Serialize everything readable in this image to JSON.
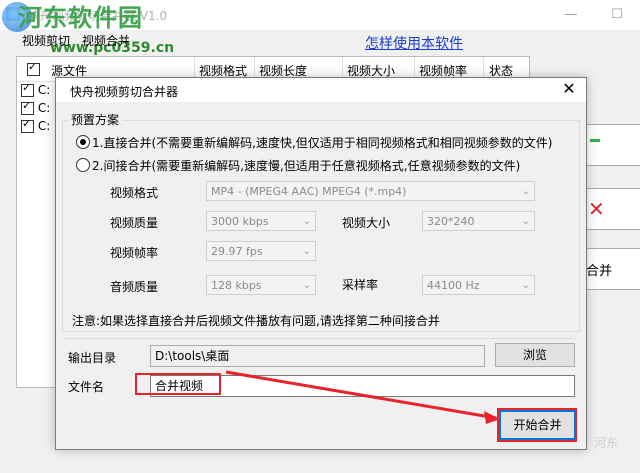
{
  "main_window": {
    "title": "快舟视频剪切合并器 V1.0",
    "menu": [
      "视频剪切",
      "视频合并"
    ],
    "help_link": "怎样使用本软件",
    "columns": [
      "源文件",
      "视频格式",
      "视频长度",
      "视频大小",
      "视频帧率",
      "状态"
    ],
    "row_prefix": [
      "C:",
      "C:",
      "C:"
    ],
    "side_button_label": "合并"
  },
  "watermark": {
    "site_name": "河东软件园",
    "url": "www.pc0359.cn",
    "corner_text": "河东"
  },
  "dialog": {
    "title": "快舟视频剪切合并器",
    "close_icon": "close-icon",
    "preset_label": "预置方案",
    "option1": "1.直接合并(不需要重新编解码,速度快,但仅适用于相同视频格式和相同视频参数的文件)",
    "option2": "2.间接合并(需要重新编解码,速度慢,但适用于任意视频格式,任意视频参数的文件)",
    "option1_selected": true,
    "fields": {
      "format_label": "视频格式",
      "format_value": "MP4 - (MPEG4 AAC) MPEG4 (*.mp4)",
      "quality_label": "视频质量",
      "quality_value": "3000 kbps",
      "size_label": "视频大小",
      "size_value": "320*240",
      "framerate_label": "视频帧率",
      "framerate_value": "29.97 fps",
      "audio_label": "音频质量",
      "audio_value": "128 kbps",
      "samplerate_label": "采样率",
      "samplerate_value": "44100 Hz"
    },
    "note": "注意:如果选择直接合并后视频文件播放有问题,请选择第二种间接合并",
    "output_dir_label": "输出目录",
    "output_dir_value": "D:\\tools\\桌面",
    "browse_label": "浏览",
    "filename_label": "文件名",
    "filename_value": "合并视频",
    "start_label": "开始合并"
  },
  "colors": {
    "highlight": "#e8242b",
    "link": "#1a3cd0",
    "primary_border": "#0078d7"
  }
}
